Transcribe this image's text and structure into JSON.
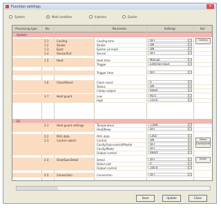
{
  "window": {
    "title": "Function settings"
  },
  "radios": [
    {
      "label": "System",
      "selected": false
    },
    {
      "label": "Mold condition",
      "selected": true
    },
    {
      "label": "Injection",
      "selected": false
    },
    {
      "label": "Ejector",
      "selected": false
    }
  ],
  "table": {
    "headers": [
      "Processing type",
      "No.",
      "Parameter",
      "Settings",
      "Set"
    ]
  },
  "groups": [
    {
      "label": "System"
    },
    {
      "label": "B2"
    }
  ],
  "rows": [
    {
      "no": "1.1",
      "name": "Cooling",
      "param": "Cooling time",
      "value": "OFF",
      "btn": "Cooling"
    },
    {
      "no": "1.2",
      "name": "Stroke",
      "param": "Stroke",
      "value": "ON"
    },
    {
      "no": "1.3",
      "name": "Eject",
      "param": "Ejector pt-mold",
      "value": "ON"
    },
    {
      "no": "1.4",
      "name": "Sensor/Ext",
      "param": "Sensor",
      "value": "OFF"
    },
    {
      "no": "1.5",
      "name": "Heat",
      "param": "Heat time",
      "value": "Manual"
    },
    {
      "no": "",
      "name": "",
      "param": "Trigger",
      "value": "External input"
    },
    {
      "no": "",
      "name": "",
      "param": "Trigger time",
      "value": "OFF"
    },
    {
      "no": "1.6",
      "name": "Close/Reset",
      "param": "Close count",
      "value": "0"
    },
    {
      "no": "",
      "name": "",
      "param": "Status",
      "value": "ON"
    },
    {
      "no": "",
      "name": "",
      "param": "Clamp output",
      "value": "Reset"
    },
    {
      "no": "1.7",
      "name": "Heat guard",
      "param": "Low",
      "value": "90.0"
    },
    {
      "no": "",
      "name": "",
      "param": "High",
      "value": "110.0"
    },
    {
      "no": "2.1",
      "name": "Heat guard settings",
      "param": "Temperature",
      "value": "1,000"
    },
    {
      "no": "",
      "name": "",
      "param": "Heat/Keep",
      "value": "OFF"
    },
    {
      "no": "2.2",
      "name": "Pt/G data",
      "param": "Pt/G data",
      "value": "Clear"
    },
    {
      "no": "2.3",
      "name": "Control switch",
      "param": "Control",
      "value": "ON",
      "btn": "Select"
    },
    {
      "no": "",
      "name": "",
      "param": "Cavity/Sub-control/Master",
      "value": "OFF",
      "btn": "Cavity/Select"
    },
    {
      "no": "",
      "name": "",
      "param": "Cavity/Mode",
      "value": "OFF"
    },
    {
      "no": "",
      "name": "",
      "param": "Output control",
      "value": "Reset"
    },
    {
      "no": "2.4",
      "name": "Shot/Sub-Detail",
      "param": "Detail",
      "value": "OFF",
      "btn": "Detail"
    },
    {
      "no": "",
      "name": "",
      "param": "Detail unit",
      "value": "0"
    },
    {
      "no": "",
      "name": "",
      "param": "Output control",
      "value": "100.0"
    },
    {
      "no": "2.5",
      "name": "Connection",
      "param": "Connection",
      "value": "OFF"
    }
  ],
  "buttons": {
    "ok": "Save",
    "apply": "Update",
    "cancel": "Close"
  }
}
